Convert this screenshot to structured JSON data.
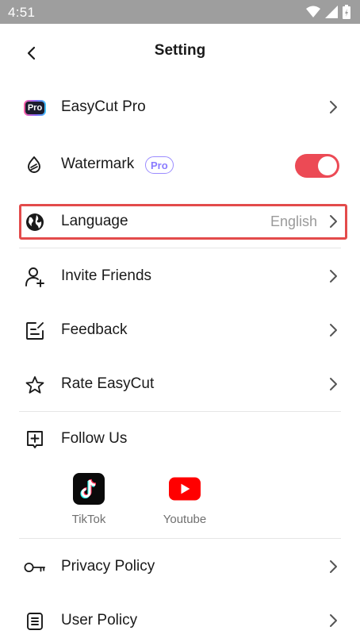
{
  "status_bar": {
    "time": "4:51",
    "icons": [
      "wifi-icon",
      "signal-icon",
      "battery-icon"
    ]
  },
  "header": {
    "title": "Setting",
    "back_icon": "chevron-left-icon"
  },
  "settings": {
    "easycut_pro": {
      "label": "EasyCut Pro",
      "icon_text": "Pro"
    },
    "watermark": {
      "label": "Watermark",
      "badge": "Pro",
      "enabled": true,
      "toggle_color": "#ec4a55"
    },
    "language": {
      "label": "Language",
      "value": "English"
    },
    "invite_friends": {
      "label": "Invite Friends"
    },
    "feedback": {
      "label": "Feedback"
    },
    "rate": {
      "label": "Rate EasyCut"
    },
    "follow_us": {
      "label": "Follow Us",
      "channels": [
        {
          "name": "TikTok",
          "icon": "tiktok-icon"
        },
        {
          "name": "Youtube",
          "icon": "youtube-icon"
        }
      ]
    },
    "privacy_policy": {
      "label": "Privacy Policy"
    },
    "user_policy": {
      "label": "User Policy"
    }
  },
  "colors": {
    "accent_red": "#ec4a55",
    "highlight_border": "#e34b4b",
    "youtube_red": "#ff0000"
  }
}
